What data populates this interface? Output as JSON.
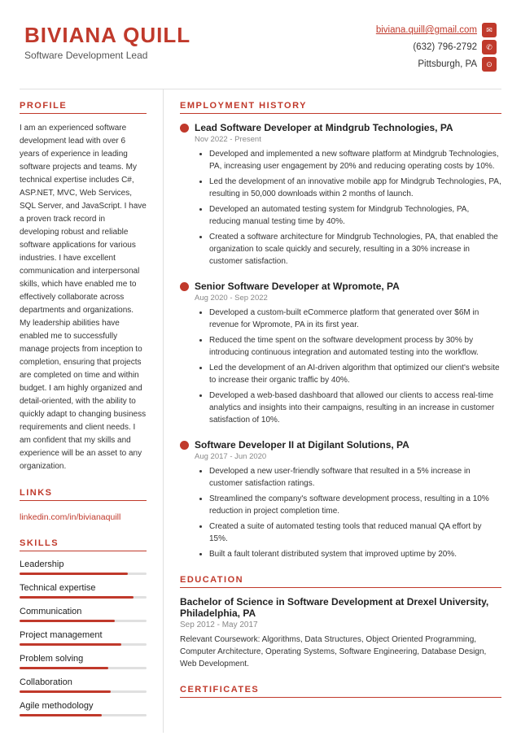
{
  "header": {
    "name": "BIVIANA QUILL",
    "title": "Software Development Lead",
    "email": "biviana.quill@gmail.com",
    "phone": "(632) 796-2792",
    "location": "Pittsburgh, PA"
  },
  "profile": {
    "section_title": "PROFILE",
    "text": "I am an experienced software development lead with over 6 years of experience in leading software projects and teams. My technical expertise includes C#, ASP.NET, MVC, Web Services, SQL Server, and JavaScript. I have a proven track record in developing robust and reliable software applications for various industries. I have excellent communication and interpersonal skills, which have enabled me to effectively collaborate across departments and organizations. My leadership abilities have enabled me to successfully manage projects from inception to completion, ensuring that projects are completed on time and within budget. I am highly organized and detail-oriented, with the ability to quickly adapt to changing business requirements and client needs. I am confident that my skills and experience will be an asset to any organization."
  },
  "links": {
    "section_title": "LINKS",
    "linkedin": "linkedin.com/in/bivianaquill"
  },
  "skills": {
    "section_title": "SKILLS",
    "items": [
      {
        "name": "Leadership",
        "percent": 85
      },
      {
        "name": "Technical expertise",
        "percent": 90
      },
      {
        "name": "Communication",
        "percent": 75
      },
      {
        "name": "Project management",
        "percent": 80
      },
      {
        "name": "Problem solving",
        "percent": 70
      },
      {
        "name": "Collaboration",
        "percent": 72
      },
      {
        "name": "Agile methodology",
        "percent": 65
      }
    ]
  },
  "employment": {
    "section_title": "EMPLOYMENT HISTORY",
    "jobs": [
      {
        "title": "Lead Software Developer at Mindgrub Technologies, PA",
        "dates": "Nov 2022 - Present",
        "bullets": [
          "Developed and implemented a new software platform at Mindgrub Technologies, PA, increasing user engagement by 20% and reducing operating costs by 10%.",
          "Led the development of an innovative mobile app for Mindgrub Technologies, PA, resulting in 50,000 downloads within 2 months of launch.",
          "Developed an automated testing system for Mindgrub Technologies, PA, reducing manual testing time by 40%.",
          "Created a software architecture for Mindgrub Technologies, PA, that enabled the organization to scale quickly and securely, resulting in a 30% increase in customer satisfaction."
        ]
      },
      {
        "title": "Senior Software Developer at Wpromote, PA",
        "dates": "Aug 2020 - Sep 2022",
        "bullets": [
          "Developed a custom-built eCommerce platform that generated over $6M in revenue for Wpromote, PA in its first year.",
          "Reduced the time spent on the software development process by 30% by introducing continuous integration and automated testing into the workflow.",
          "Led the development of an AI-driven algorithm that optimized our client's website to increase their organic traffic by 40%.",
          "Developed a web-based dashboard that allowed our clients to access real-time analytics and insights into their campaigns, resulting in an increase in customer satisfaction of 10%."
        ]
      },
      {
        "title": "Software Developer II at Digilant Solutions, PA",
        "dates": "Aug 2017 - Jun 2020",
        "bullets": [
          "Developed a new user-friendly software that resulted in a 5% increase in customer satisfaction ratings.",
          "Streamlined the company's software development process, resulting in a 10% reduction in project completion time.",
          "Created a suite of automated testing tools that reduced manual QA effort by 15%.",
          "Built a fault tolerant distributed system that improved uptime by 20%."
        ]
      }
    ]
  },
  "education": {
    "section_title": "EDUCATION",
    "degree": "Bachelor of Science in Software Development at Drexel University, Philadelphia, PA",
    "dates": "Sep 2012 - May 2017",
    "coursework": "Relevant Coursework: Algorithms, Data Structures, Object Oriented Programming, Computer Architecture, Operating Systems, Software Engineering, Database Design, Web Development."
  },
  "certificates": {
    "section_title": "CERTIFICATES"
  }
}
